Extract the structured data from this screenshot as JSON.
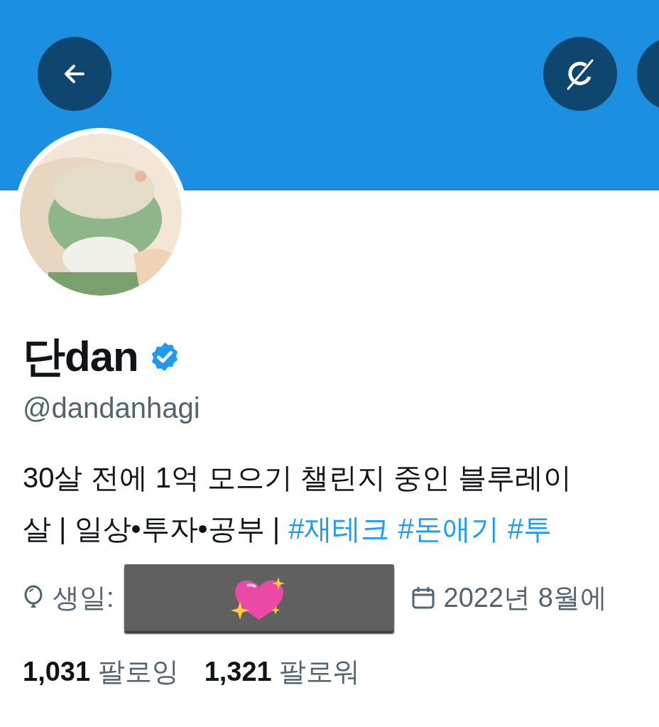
{
  "header": {
    "buttons": [
      {
        "kind": "back"
      },
      {
        "kind": "slashed-circle"
      },
      {
        "kind": "partial"
      }
    ]
  },
  "profile": {
    "avatar": {
      "kind": "picture"
    },
    "name": "단dan",
    "verified": true,
    "handle": "@dandanhagi",
    "bio": [
      [
        {
          "kind": "plain",
          "text": "30살 전에 1억 모으기 챌린지 중인 블루레이"
        }
      ],
      [
        {
          "kind": "plain",
          "text": "살 | 일상•투자•공부 |"
        },
        {
          "kind": "hashtag",
          "text": "#재테크"
        },
        {
          "kind": "hashtag",
          "text": "#돈애기"
        },
        {
          "kind": "hashtag",
          "text": "#투"
        }
      ]
    ],
    "meta": {
      "birthday_label": "생일:",
      "birthday_redacted": true,
      "joined": "2022년 8월에"
    },
    "stats": [
      {
        "count": "1,031",
        "label": "팔로잉"
      },
      {
        "count": "1,321",
        "label": "팔로워"
      }
    ]
  }
}
